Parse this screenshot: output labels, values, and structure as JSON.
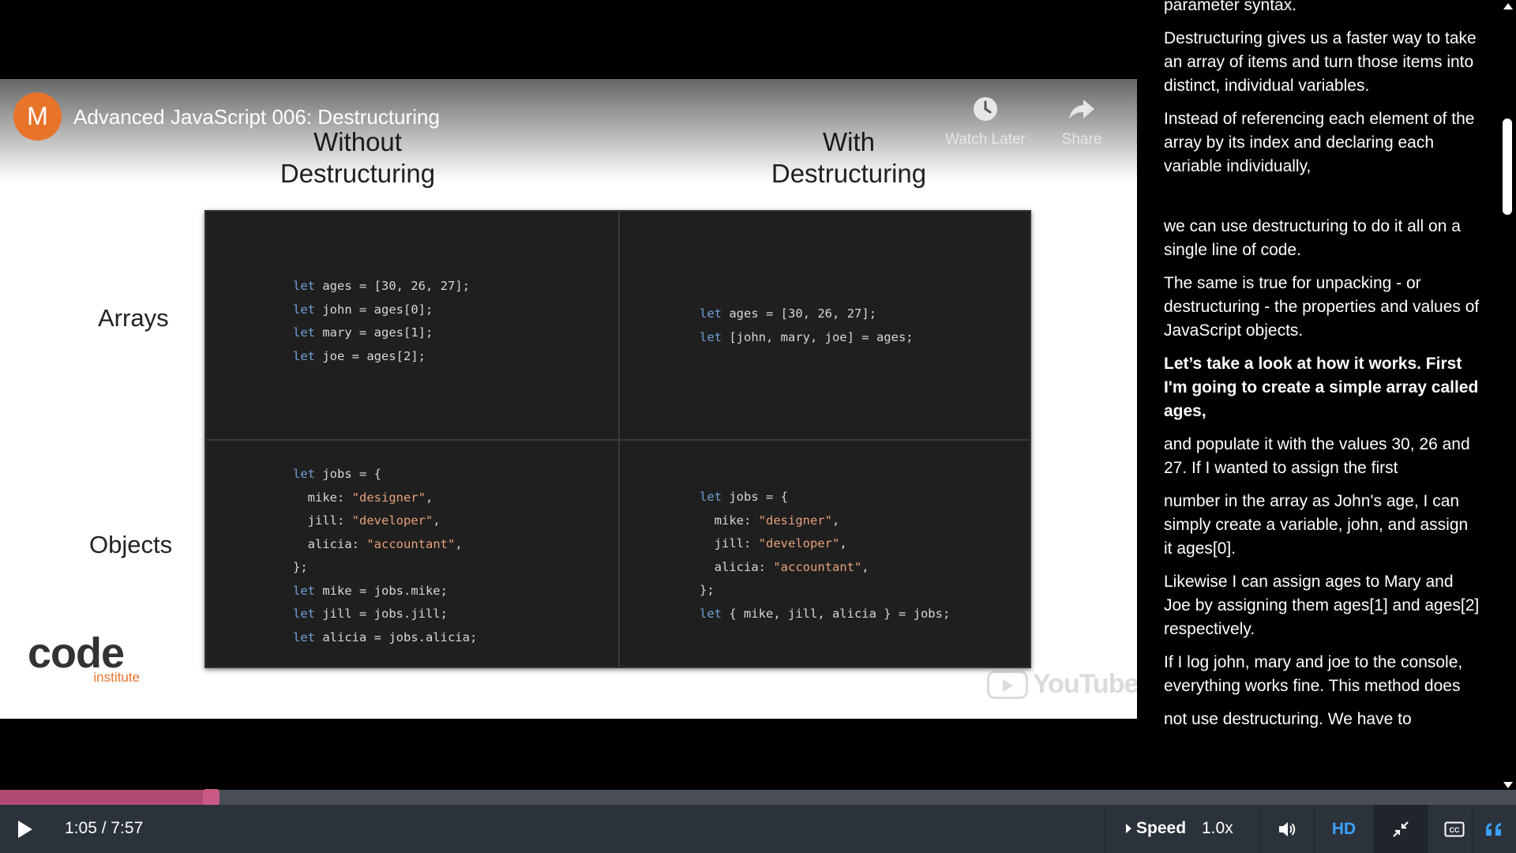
{
  "video": {
    "title": "Advanced JavaScript 006: Destructuring",
    "channel_initial": "M",
    "watch_later_label": "Watch Later",
    "share_label": "Share"
  },
  "slide": {
    "col_without": "Without\nDestructuring",
    "col_with": "With\nDestructuring",
    "row_arrays": "Arrays",
    "row_objects": "Objects",
    "code_arrays_without": "let ages = [30, 26, 27];\nlet john = ages[0];\nlet mary = ages[1];\nlet joe = ages[2];",
    "code_arrays_with": "let ages = [30, 26, 27];\nlet [john, mary, joe] = ages;",
    "code_objects_without": "let jobs = {\n  mike: \"designer\",\n  jill: \"developer\",\n  alicia: \"accountant\",\n};\nlet mike = jobs.mike;\nlet jill = jobs.jill;\nlet alicia = jobs.alicia;",
    "code_objects_with": "let jobs = {\n  mike: \"designer\",\n  jill: \"developer\",\n  alicia: \"accountant\",\n};\nlet { mike, jill, alicia } = jobs;",
    "logo_main": "code",
    "logo_sub": "institute",
    "watermark": "YouTube"
  },
  "transcript": [
    {
      "text": "parameter syntax.",
      "active": false
    },
    {
      "text": "Destructuring gives us a faster way to take an array of items and turn those items into distinct, individual variables.",
      "active": false
    },
    {
      "text": "Instead of referencing each element of the  array by its index and declaring each variable individually,",
      "active": false
    },
    {
      "text": "we can use destructuring  to do it all on a single line of code.",
      "active": false
    },
    {
      "text": "The same is true for unpacking - or destructuring  - the properties and values of JavaScript objects.",
      "active": false
    },
    {
      "text": "Let’s take a look at how it works. First I'm going to create a simple array called ages,",
      "active": true
    },
    {
      "text": "and populate it with the values 30, 26 and 27. If I wanted to assign the first",
      "active": false
    },
    {
      "text": "number in the array as John's age, I can simply  create a variable, john, and assign it ages[0].",
      "active": false
    },
    {
      "text": "Likewise I can assign ages to Mary and  Joe by assigning them ages[1] and ages[2] respectively.",
      "active": false
    },
    {
      "text": "If I log john, mary and joe to the console, everything works fine. This method does",
      "active": false
    },
    {
      "text": "not use destructuring. We have to",
      "active": false
    }
  ],
  "player": {
    "time": "1:05 / 7:57",
    "progress_fraction": 0.136,
    "speed_label": "Speed",
    "speed_value": "1.0x",
    "hd_label": "HD",
    "colors": {
      "progress": "#b04a72",
      "accent": "#3aa0ff"
    }
  }
}
